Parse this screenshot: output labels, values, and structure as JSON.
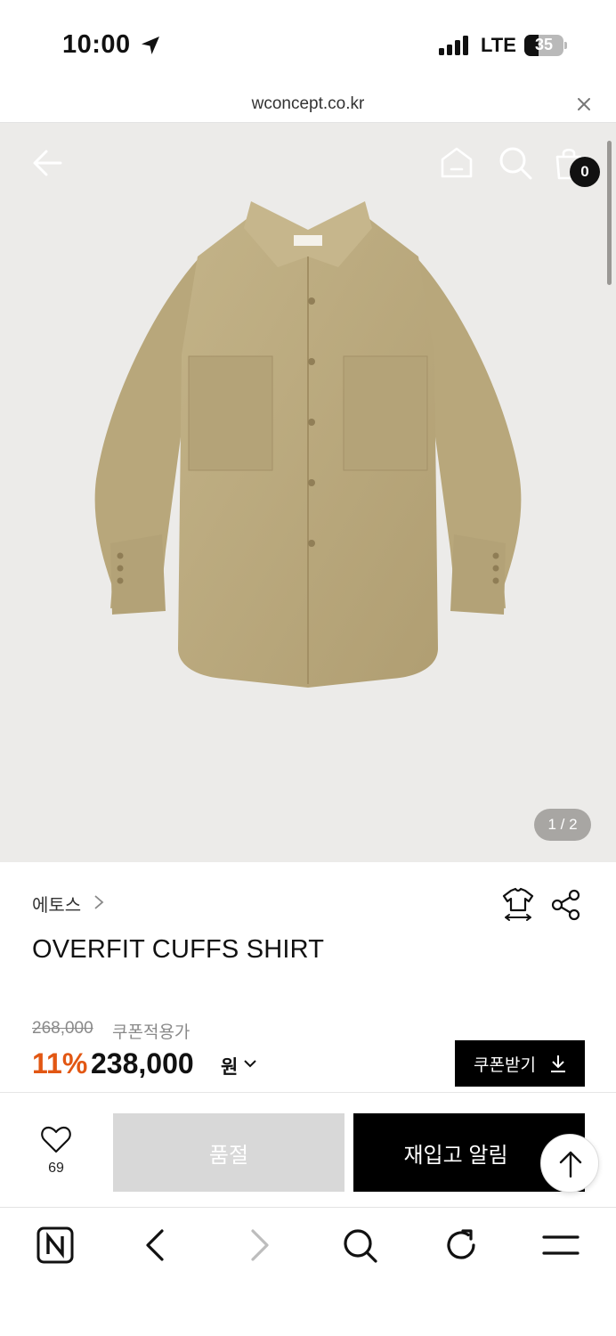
{
  "status_bar": {
    "time": "10:00",
    "network": "LTE",
    "battery": "35"
  },
  "url_bar": {
    "url": "wconcept.co.kr"
  },
  "header": {
    "cart_count": "0"
  },
  "gallery": {
    "counter": "1 / 2",
    "shirt_color": "#bcab80"
  },
  "product": {
    "brand": "에토스",
    "name": "OVERFIT CUFFS SHIRT",
    "original_price": "268,000",
    "coupon_note": "쿠폰적용가",
    "discount": "11%",
    "price": "238,000",
    "currency": "원",
    "coupon_button": "쿠폰받기"
  },
  "actions": {
    "like_count": "69",
    "soldout_label": "품절",
    "restock_label": "재입고 알림"
  },
  "colors": {
    "accent": "#e25713",
    "primary": "#000000",
    "disabled": "#d8d8d8"
  }
}
